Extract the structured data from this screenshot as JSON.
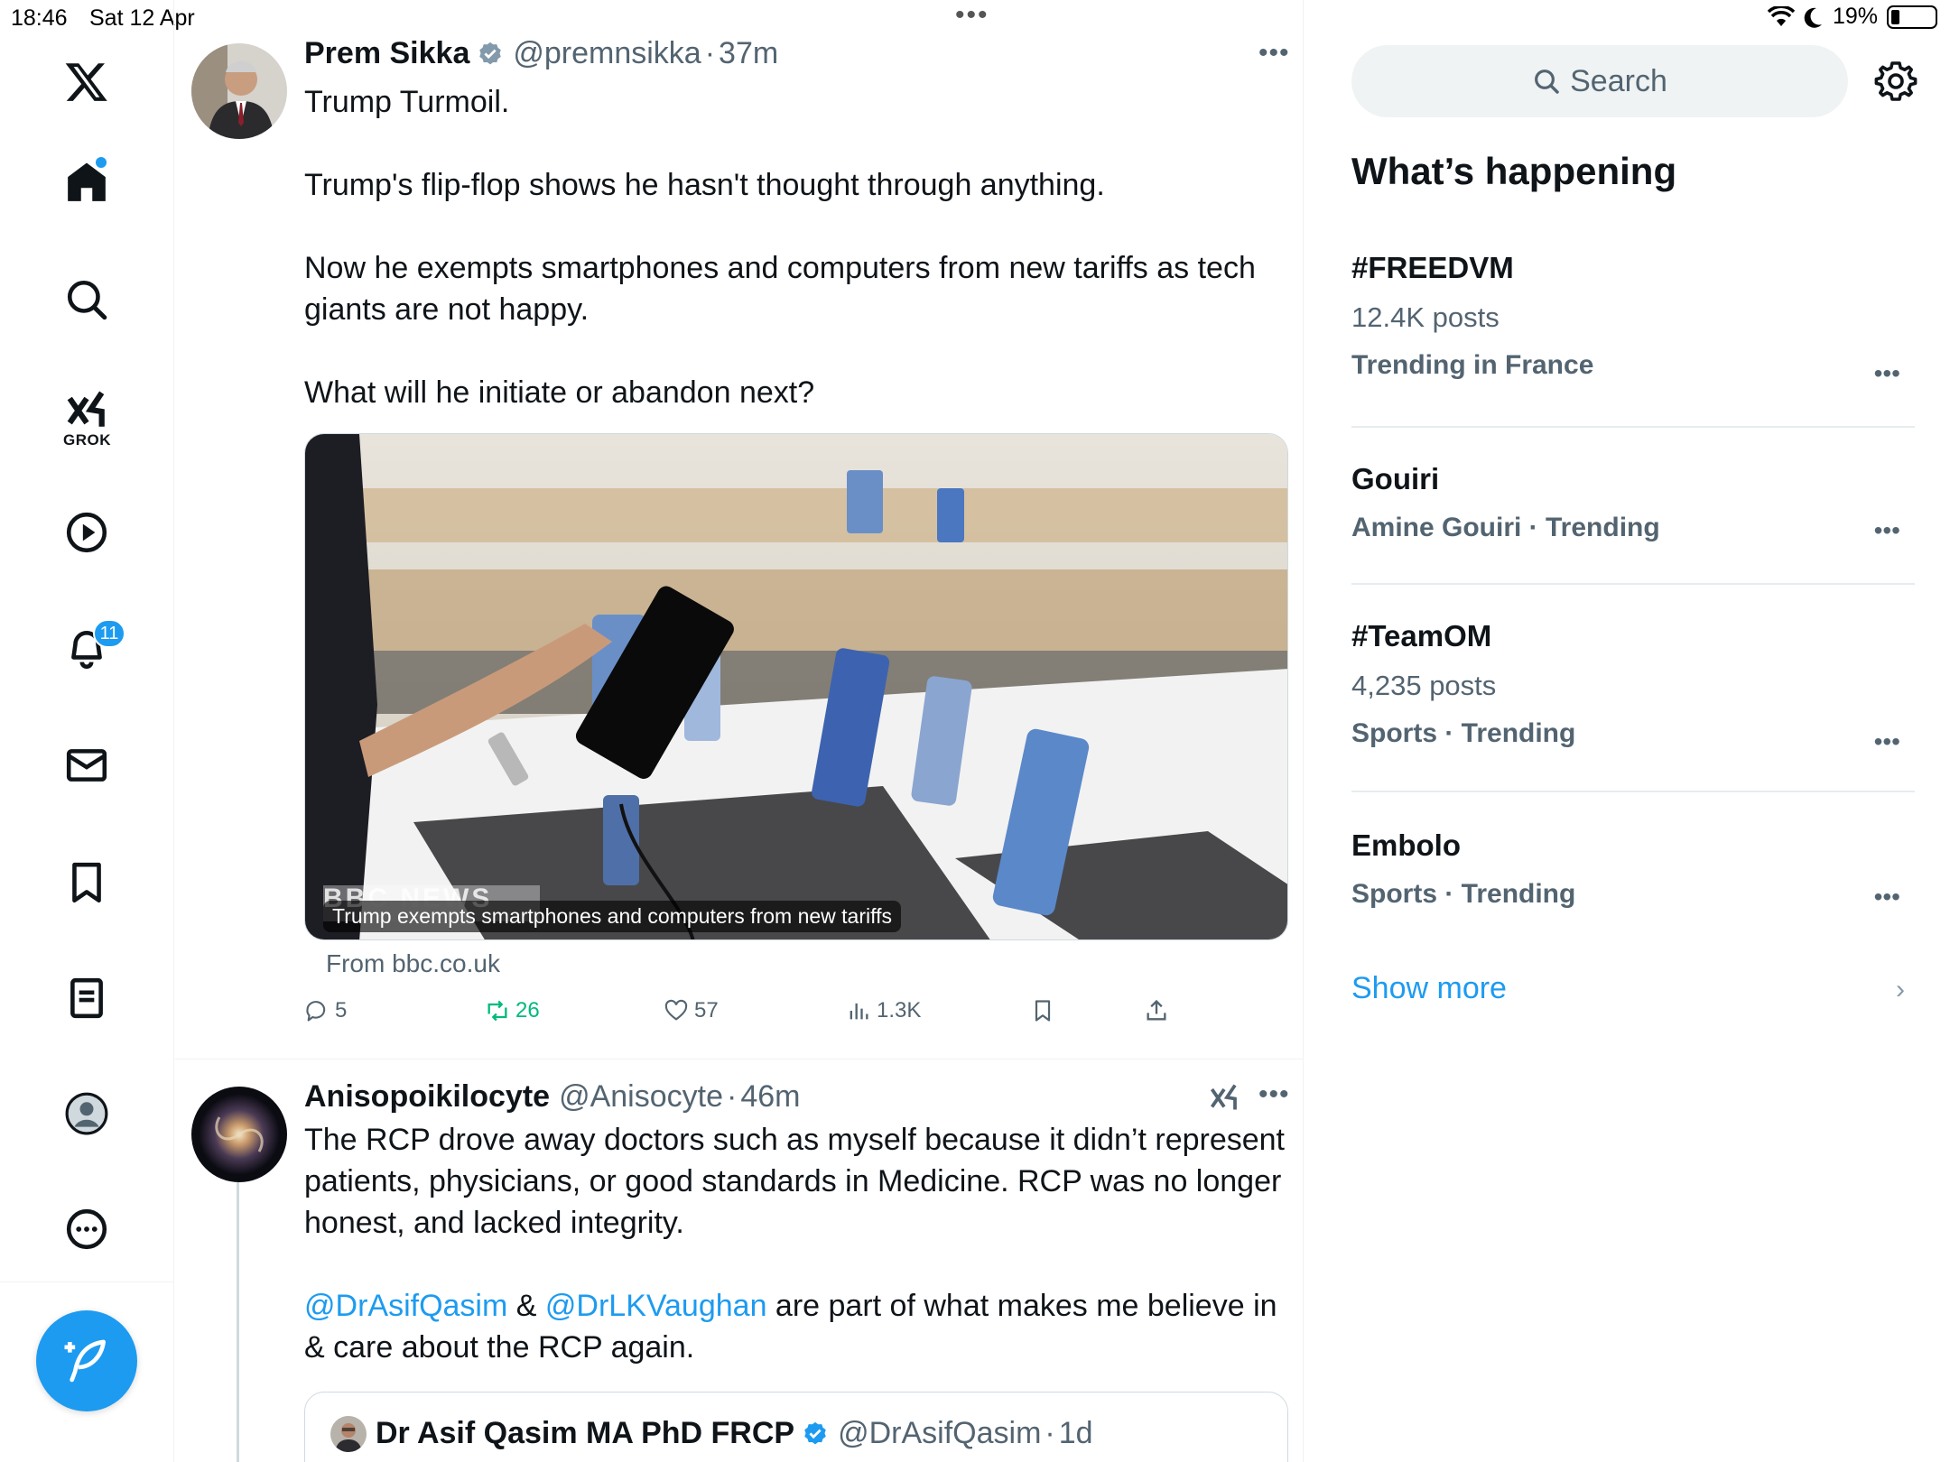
{
  "status": {
    "time": "18:46",
    "date": "Sat 12 Apr",
    "battery": "19%",
    "battery_level": 0.19
  },
  "nav": {
    "notifications_badge": "11",
    "grok_label": "GROK"
  },
  "posts": [
    {
      "name": "Prem Sikka",
      "handle": "@premnsikka",
      "sep": "·",
      "time": "37m",
      "paragraphs": [
        "Trump Turmoil.",
        "Trump's flip-flop shows he hasn't thought through anything.",
        "Now he exempts smartphones and computers from new tariffs as tech giants are not happy.",
        "What will he initiate or abandon next?"
      ],
      "media_caption": "Trump exempts smartphones and computers from new tariffs",
      "media_watermark": "BBC NEWS",
      "from": "From bbc.co.uk",
      "replies": "5",
      "reposts": "26",
      "likes": "57",
      "views": "1.3K"
    },
    {
      "name": "Anisopoikilocyte",
      "handle": "@Anisocyte",
      "sep": "·",
      "time": "46m",
      "text1": "The RCP drove away doctors such as myself because it didn’t represent patients, physicians, or good standards in Medicine. RCP was no longer honest, and lacked integrity.",
      "mention1": "@DrAsifQasim",
      "amp": " & ",
      "mention2": "@DrLKVaughan",
      "text2": " are part of what makes me believe in & care about the RCP again.",
      "quote": {
        "name": "Dr Asif Qasim MA PhD FRCP",
        "handle": "@DrAsifQasim",
        "sep": "·",
        "time": "1d"
      }
    }
  ],
  "sidebar": {
    "search_placeholder": "Search",
    "title": "What’s happening",
    "trends": [
      {
        "name": "#FREEDVM",
        "posts": "12.4K posts",
        "context": "Trending in France"
      },
      {
        "name": "Gouiri",
        "context": "Amine Gouiri · Trending"
      },
      {
        "name": "#TeamOM",
        "posts": "4,235 posts",
        "context": "Sports · Trending"
      },
      {
        "name": "Embolo",
        "context": "Sports · Trending"
      }
    ],
    "show_more": "Show more"
  },
  "colors": {
    "accent": "#1d9bf0",
    "repost": "#00ba7c",
    "muted": "#536471"
  }
}
